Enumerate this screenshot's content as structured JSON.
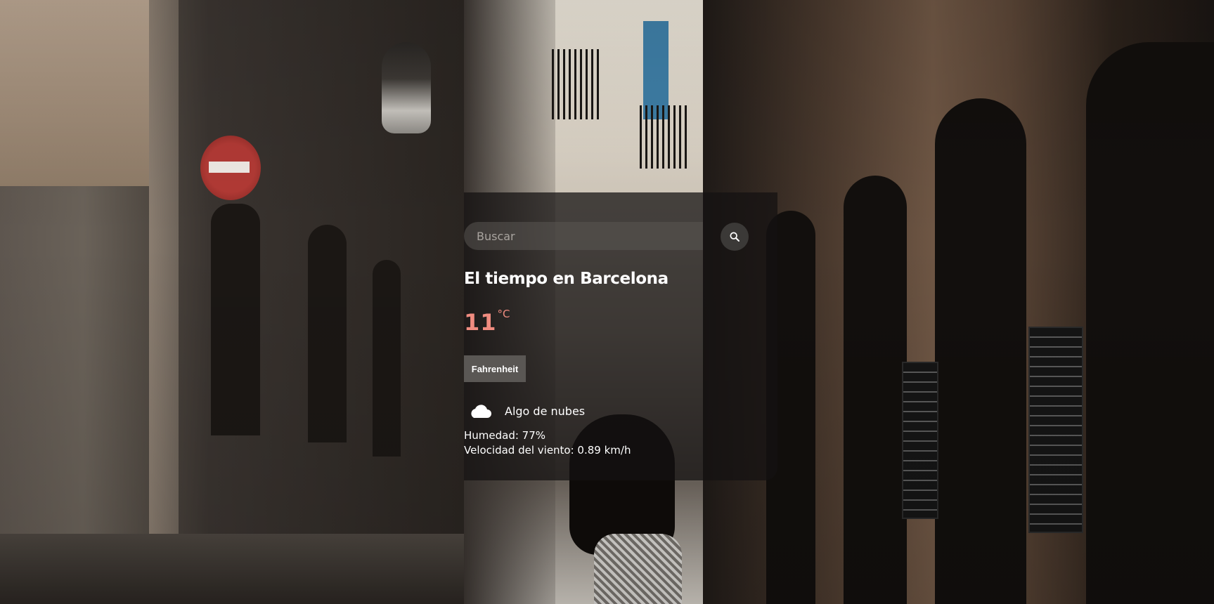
{
  "search": {
    "placeholder": "Buscar",
    "value": "",
    "button_icon": "search-icon"
  },
  "weather": {
    "title": "El tiempo en Barcelona",
    "temperature": "11",
    "temperature_unit": "°C",
    "unit_toggle_label": "Fahrenheit",
    "condition_icon": "cloud-icon",
    "description": "Algo de nubes",
    "humidity": "Humedad: 77%",
    "wind": "Velocidad del viento: 0.89 km/h"
  },
  "colors": {
    "temperature": "#f08c80",
    "card_background": "rgba(20,18,17,0.74)",
    "toggle_button": "#5a5754"
  }
}
